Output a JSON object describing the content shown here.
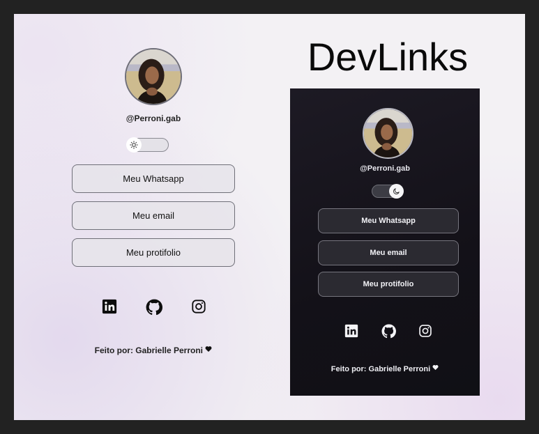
{
  "page": {
    "title": "DevLinks"
  },
  "light": {
    "handle": "@Perroni.gab",
    "buttons": [
      "Meu Whatsapp",
      "Meu email",
      "Meu protifolio"
    ],
    "footer": "Feito por: Gabrielle Perroni",
    "theme_icon": "sun-icon"
  },
  "dark": {
    "handle": "@Perroni.gab",
    "buttons": [
      "Meu Whatsapp",
      "Meu email",
      "Meu protifolio"
    ],
    "footer": "Feito por: Gabrielle Perroni",
    "theme_icon": "moon-icon"
  },
  "socials": [
    "linkedin-icon",
    "github-icon",
    "instagram-icon"
  ],
  "colors": {
    "light_bg": "#f3f1f4",
    "dark_bg": "#131118",
    "outer_bg": "#222222"
  }
}
